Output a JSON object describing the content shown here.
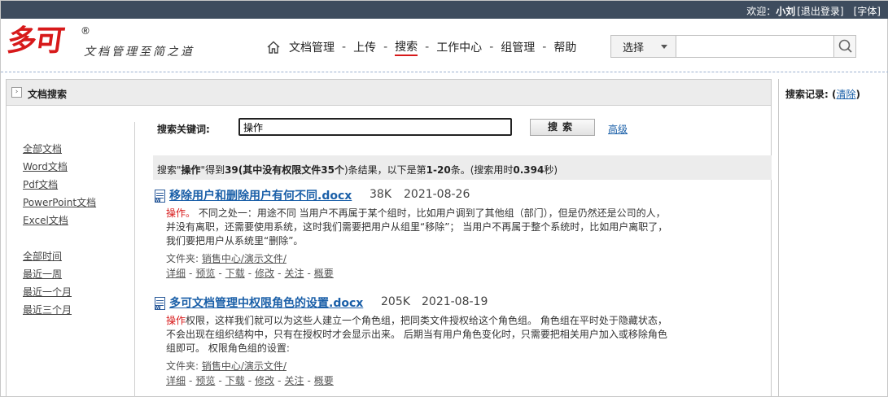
{
  "topbar": {
    "welcome": "欢迎：",
    "user": "小刘",
    "logout": "[退出登录]",
    "font": "[字体]"
  },
  "brand": {
    "logo": "多可",
    "reg": "®",
    "slogan": "文档管理至简之道"
  },
  "nav": {
    "items": [
      "文档管理",
      "上传",
      "搜索",
      "工作中心",
      "组管理",
      "帮助"
    ],
    "active": "搜索",
    "separator": "-"
  },
  "top_search": {
    "select_label": "选择",
    "value": "",
    "placeholder": ""
  },
  "panel": {
    "title": "文档搜索",
    "toggle_glyph": "›"
  },
  "sidebar": {
    "types": [
      "全部文档",
      "Word文档",
      "Pdf文档",
      "PowerPoint文档",
      "Excel文档"
    ],
    "times": [
      "全部时间",
      "最近一周",
      "最近一个月",
      "最近三个月"
    ]
  },
  "search_form": {
    "label": "搜索关键词:",
    "value": "操作",
    "button": "搜索",
    "advanced": "高级"
  },
  "summary": {
    "p1": "搜索\"",
    "keyword": "操作",
    "p2": "\"得到",
    "total": "39",
    "p3": "(其中没有权限文件",
    "no_perm": "35个",
    "p4": ")条结果，以下是第",
    "range": "1-20",
    "p5": "条。(搜索用时",
    "time": "0.394",
    "p6": "秒)"
  },
  "results": [
    {
      "title": "移除用户和删除用户有何不同.docx",
      "size": "38K",
      "date": "2021-08-26",
      "snippet_hl": "操作。",
      "snippet": " 不同之处一：用途不同 当用户不再属于某个组时，比如用户调到了其他组（部门），但是仍然还是公司的人，并没有离职，还需要使用系统，这时我们需要把用户从组里“移除”； 当用户不再属于整个系统时，比如用户离职了，我们要把用户从系统里“删除”。",
      "folder_label": "文件夹: ",
      "folder": "销售中心/演示文件/",
      "actions": [
        "详细",
        "预览",
        "下载",
        "修改",
        "关注",
        "概要"
      ]
    },
    {
      "title": "多可文档管理中权限角色的设置.docx",
      "size": "205K",
      "date": "2021-08-19",
      "snippet_hl": "操作",
      "snippet": "权限，这样我们就可以为这些人建立一个角色组，把同类文件授权给这个角色组。 角色组在平时处于隐藏状态，不会出现在组织结构中，只有在授权时才会显示出来。 后期当有用户角色变化时，只需要把相关用户加入或移除角色组即可。 权限角色组的设置:",
      "folder_label": "文件夹: ",
      "folder": "销售中心/演示文件/",
      "actions": [
        "详细",
        "预览",
        "下载",
        "修改",
        "关注",
        "概要"
      ]
    }
  ],
  "history": {
    "label": "搜索记录:",
    "open": " (",
    "clear": "清除",
    "close": ")"
  },
  "colors": {
    "topbar": "#3e4c5e",
    "brand_red": "#d7191a",
    "link_blue": "#1a5fa8",
    "panel_gray": "#ececec"
  }
}
